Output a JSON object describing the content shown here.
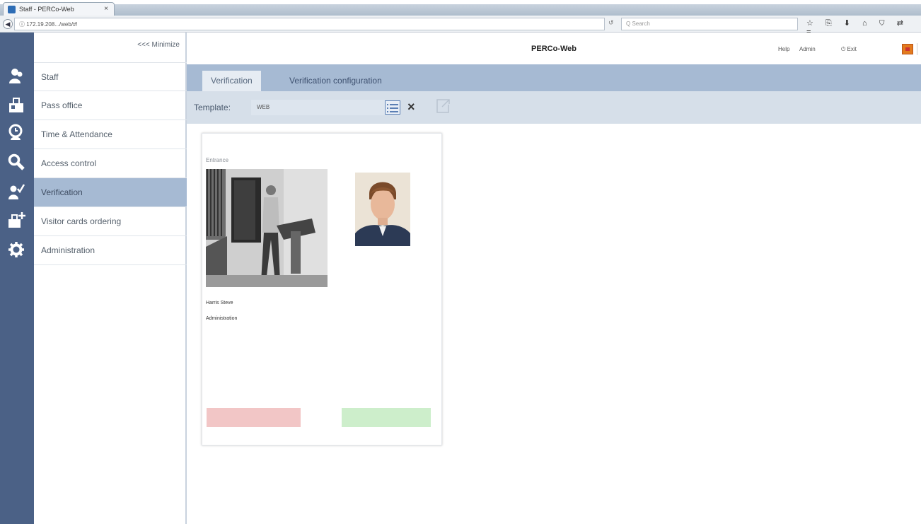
{
  "browser": {
    "tab_title": "Staff - PERCo-Web",
    "tab_close": "×",
    "back_arrow": "◀",
    "url": "ⓘ 172.19.208.../web/#!",
    "reload": "↺",
    "search_placeholder": "Q Search",
    "toolbar_icons": "☆ ⎘ ⬇ ⌂ ⛉ ⇄ ≡"
  },
  "header": {
    "app_title": "PERCo-Web",
    "help": "Help",
    "admin": "Admin",
    "exit": "⏻ Exit"
  },
  "sidebar": {
    "minimize_label": "<<< Minimize",
    "items": [
      {
        "label": "Staff",
        "icon": "staff-icon"
      },
      {
        "label": "Pass office",
        "icon": "pass-office-icon"
      },
      {
        "label": "Time & Attendance",
        "icon": "time-attendance-icon"
      },
      {
        "label": "Access control",
        "icon": "access-control-icon"
      },
      {
        "label": "Verification",
        "icon": "verification-icon"
      },
      {
        "label": "Visitor cards ordering",
        "icon": "visitor-cards-icon"
      },
      {
        "label": "Administration",
        "icon": "administration-icon"
      }
    ],
    "active_index": 4
  },
  "tabs": {
    "verification": "Verification",
    "verification_config": "Verification configuration"
  },
  "toolbar": {
    "template_label": "Template:",
    "template_value": "WEB",
    "clear_symbol": "×"
  },
  "card": {
    "event_label": "Entrance",
    "name": "Harris Steve",
    "department": "Administration"
  },
  "colors": {
    "rail": "#4b6186",
    "accent_blue": "#a6bad3",
    "deny": "#f2c6c6",
    "allow": "#cdeecb"
  }
}
